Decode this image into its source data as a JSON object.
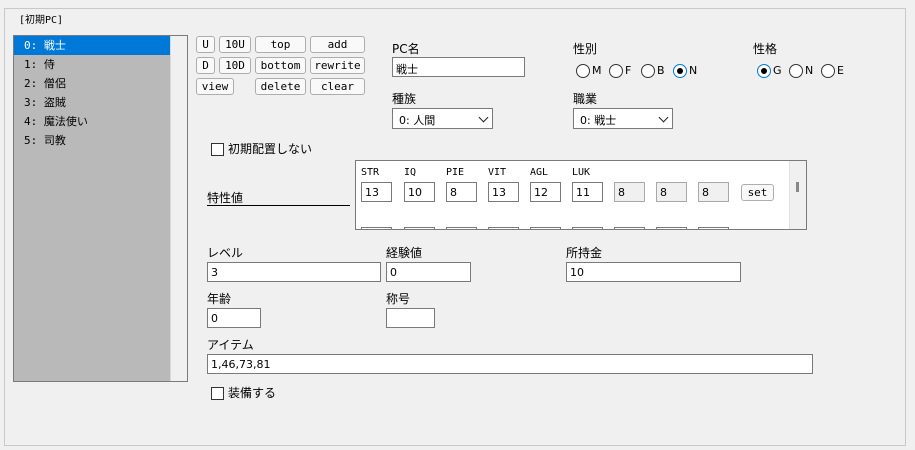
{
  "group": {
    "title": "[初期PC]"
  },
  "pc_list": {
    "items": [
      {
        "label": "0: 戦士"
      },
      {
        "label": "1: 侍"
      },
      {
        "label": "2: 僧侶"
      },
      {
        "label": "3: 盗賊"
      },
      {
        "label": "4: 魔法使い"
      },
      {
        "label": "5: 司教"
      }
    ],
    "selected_index": 0
  },
  "buttons": {
    "u": "U",
    "u10": "10U",
    "top": "top",
    "add": "add",
    "d": "D",
    "d10": "10D",
    "bottom": "bottom",
    "rewrite": "rewrite",
    "view": "view",
    "delete": "delete",
    "clear": "clear",
    "set": "set"
  },
  "pc_name": {
    "label": "PC名",
    "value": "戦士"
  },
  "sex": {
    "label": "性別",
    "options": [
      "M",
      "F",
      "B",
      "N"
    ],
    "selected": "N"
  },
  "alignment": {
    "label": "性格",
    "options": [
      "G",
      "N",
      "E"
    ],
    "selected": "G"
  },
  "race": {
    "label": "種族",
    "value": "0: 人間"
  },
  "job": {
    "label": "職業",
    "value": "0: 戦士"
  },
  "initial_placement": {
    "label": "初期配置しない",
    "checked": false
  },
  "stats": {
    "label": "特性値",
    "headers": [
      "STR",
      "IQ",
      "PIE",
      "VIT",
      "AGL",
      "LUK"
    ],
    "values": [
      "13",
      "10",
      "8",
      "13",
      "12",
      "11"
    ],
    "extra_values": [
      "8",
      "8",
      "8"
    ]
  },
  "level": {
    "label": "レベル",
    "value": "3"
  },
  "exp": {
    "label": "経験値",
    "value": "0"
  },
  "gold": {
    "label": "所持金",
    "value": "10"
  },
  "age": {
    "label": "年齢",
    "value": "0"
  },
  "title_field": {
    "label": "称号",
    "value": ""
  },
  "items": {
    "label": "アイテム",
    "value": "1,46,73,81"
  },
  "equip": {
    "label": "装備する",
    "checked": false
  }
}
